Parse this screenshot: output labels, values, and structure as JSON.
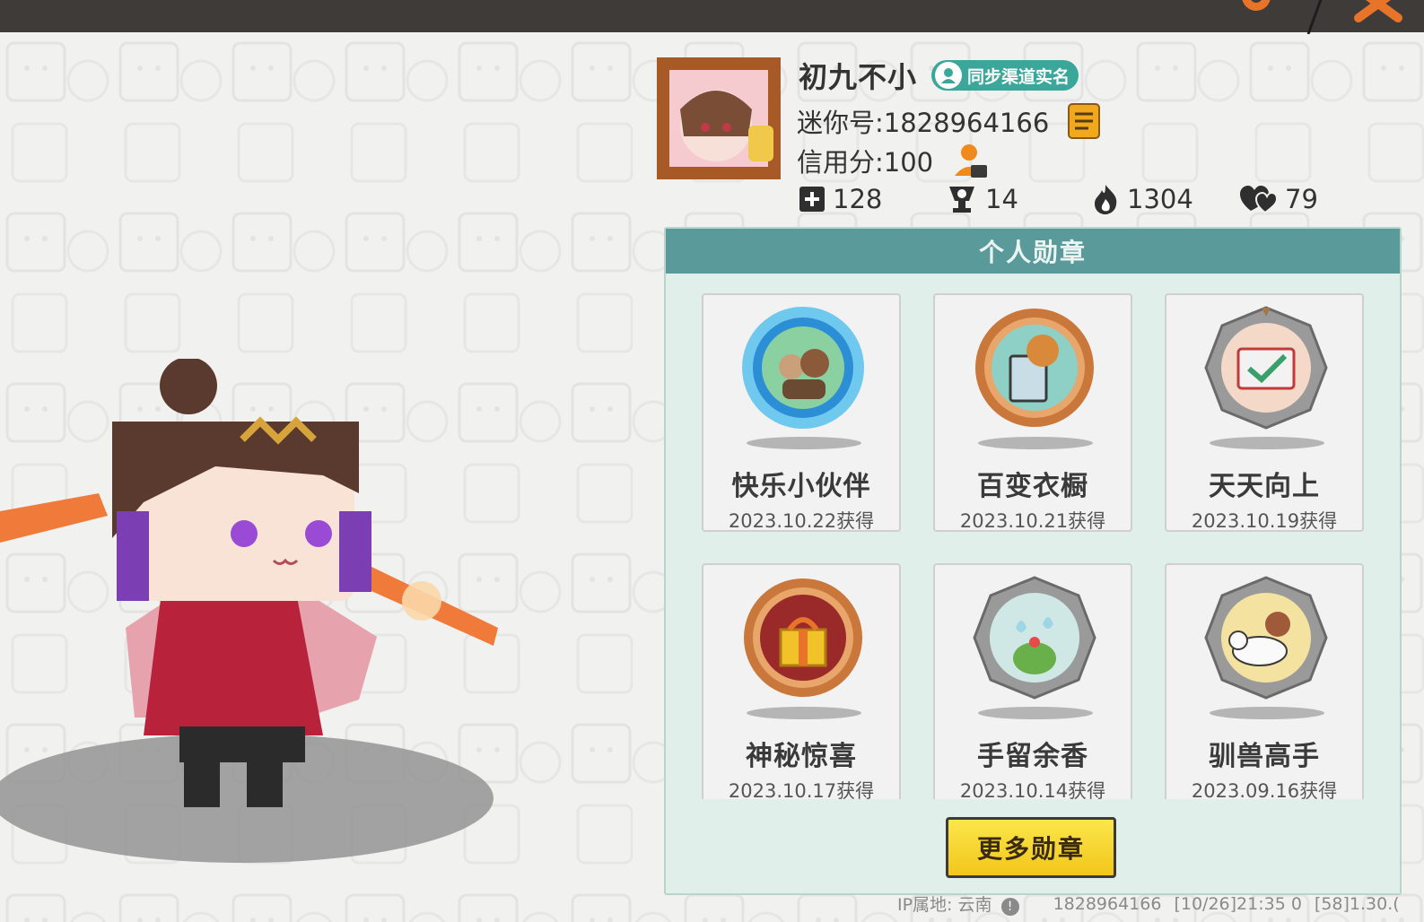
{
  "profile": {
    "nickname": "初九不小",
    "realname_badge": "同步渠道实名",
    "mini_id": "迷你号:1828964166",
    "credit": "信用分:100",
    "stats": [
      {
        "icon": "plus-square-icon",
        "value": "128"
      },
      {
        "icon": "trophy-icon",
        "value": "14"
      },
      {
        "icon": "flame-icon",
        "value": "1304"
      },
      {
        "icon": "hearts-icon",
        "value": "79"
      }
    ]
  },
  "medals": {
    "header": "个人勋章",
    "items": [
      {
        "title": "快乐小伙伴",
        "date": "2023.10.22获得",
        "style": "blue-crystal"
      },
      {
        "title": "百变衣橱",
        "date": "2023.10.21获得",
        "style": "bronze"
      },
      {
        "title": "天天向上",
        "date": "2023.10.19获得",
        "style": "stone"
      },
      {
        "title": "神秘惊喜",
        "date": "2023.10.17获得",
        "style": "bronze-red"
      },
      {
        "title": "手留余香",
        "date": "2023.10.14获得",
        "style": "stone"
      },
      {
        "title": "驯兽高手",
        "date": "2023.09.16获得",
        "style": "stone"
      }
    ],
    "more_button": "更多勋章"
  },
  "footer": {
    "ip_location": "IP属地: 云南",
    "uid": "1828964166",
    "timestamp": "[10/26]21:35 0",
    "version": "[58]1.30.("
  },
  "colors": {
    "topbar": "#3e3b38",
    "accent_orange": "#e8742a",
    "panel_header": "#5a9a9a",
    "panel_bg": "#e0efe9",
    "badge_teal": "#3aa79a",
    "button_yellow": "#f2c61b"
  }
}
